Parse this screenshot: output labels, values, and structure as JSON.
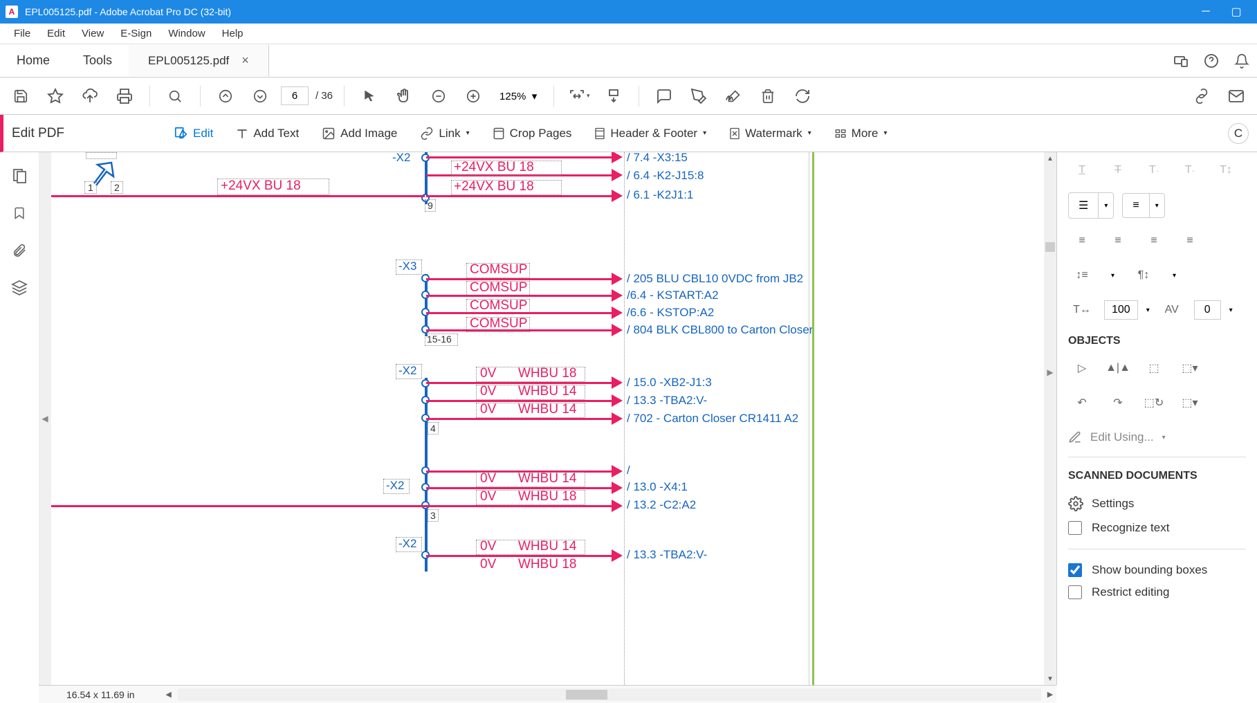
{
  "window": {
    "title": "EPL005125.pdf - Adobe Acrobat Pro DC (32-bit)"
  },
  "menu": [
    "File",
    "Edit",
    "View",
    "E-Sign",
    "Window",
    "Help"
  ],
  "tabs": {
    "home": "Home",
    "tools": "Tools",
    "doc_name": "EPL005125.pdf"
  },
  "toolbar": {
    "page_current": "6",
    "page_total": "/  36",
    "zoom": "125%"
  },
  "edit_pdf": {
    "title": "Edit PDF",
    "edit": "Edit",
    "add_text": "Add Text",
    "add_image": "Add Image",
    "link": "Link",
    "crop": "Crop Pages",
    "header": "Header & Footer",
    "watermark": "Watermark",
    "more": "More"
  },
  "diagram": {
    "top": {
      "left_wire": "+24VX    BU 18",
      "x2": "-X2",
      "lines": [
        "+24VX    BU 18",
        "+24VX    BU 18"
      ],
      "refs": [
        "/ 7.4 -X3:15",
        "/ 6.4 -K2-J15:8",
        "/ 6.1 -K2J1:1"
      ],
      "num1": "1",
      "num2": "2",
      "num9": "9"
    },
    "x3": {
      "label": "-X3",
      "lines": [
        "COMSUP",
        "COMSUP",
        "COMSUP",
        "COMSUP"
      ],
      "refs": [
        "/ 205 BLU CBL10 0VDC from JB2",
        "/6.4 - KSTART:A2",
        "/6.6 - KSTOP:A2",
        "/ 804 BLK CBL800 to Carton Closer"
      ],
      "num": "15-16"
    },
    "x2b": {
      "label": "-X2",
      "lines": [
        {
          "l": "0V",
          "r": "WHBU 18"
        },
        {
          "l": "0V",
          "r": "WHBU 14"
        },
        {
          "l": "0V",
          "r": "WHBU 14"
        }
      ],
      "refs": [
        "/ 15.0 -XB2-J1:3",
        "/ 13.3 -TBA2:V-",
        "/ 702 - Carton Closer CR1411 A2"
      ],
      "num": "4"
    },
    "x2c": {
      "label": "-X2",
      "lines": [
        {
          "l": "0V",
          "r": "WHBU 14"
        },
        {
          "l": "0V",
          "r": "WHBU 18"
        }
      ],
      "refs": [
        "/",
        "/ 13.0 -X4:1",
        "/ 13.2 -C2:A2"
      ],
      "num": "3"
    },
    "x2d": {
      "label": "-X2",
      "lines": [
        {
          "l": "0V",
          "r": "WHBU 14"
        },
        {
          "l": "0V",
          "r": "WHBU 18"
        }
      ],
      "refs": [
        "/ 13.3 -TBA2:V-"
      ]
    }
  },
  "right_panel": {
    "text_size": "100",
    "spacing": "0",
    "objects": "OBJECTS",
    "edit_using": "Edit Using...",
    "scanned": "SCANNED DOCUMENTS",
    "settings": "Settings",
    "recognize": "Recognize text",
    "show_bb": "Show bounding boxes",
    "restrict": "Restrict editing"
  },
  "status": {
    "dims": "16.54 x 11.69 in"
  }
}
